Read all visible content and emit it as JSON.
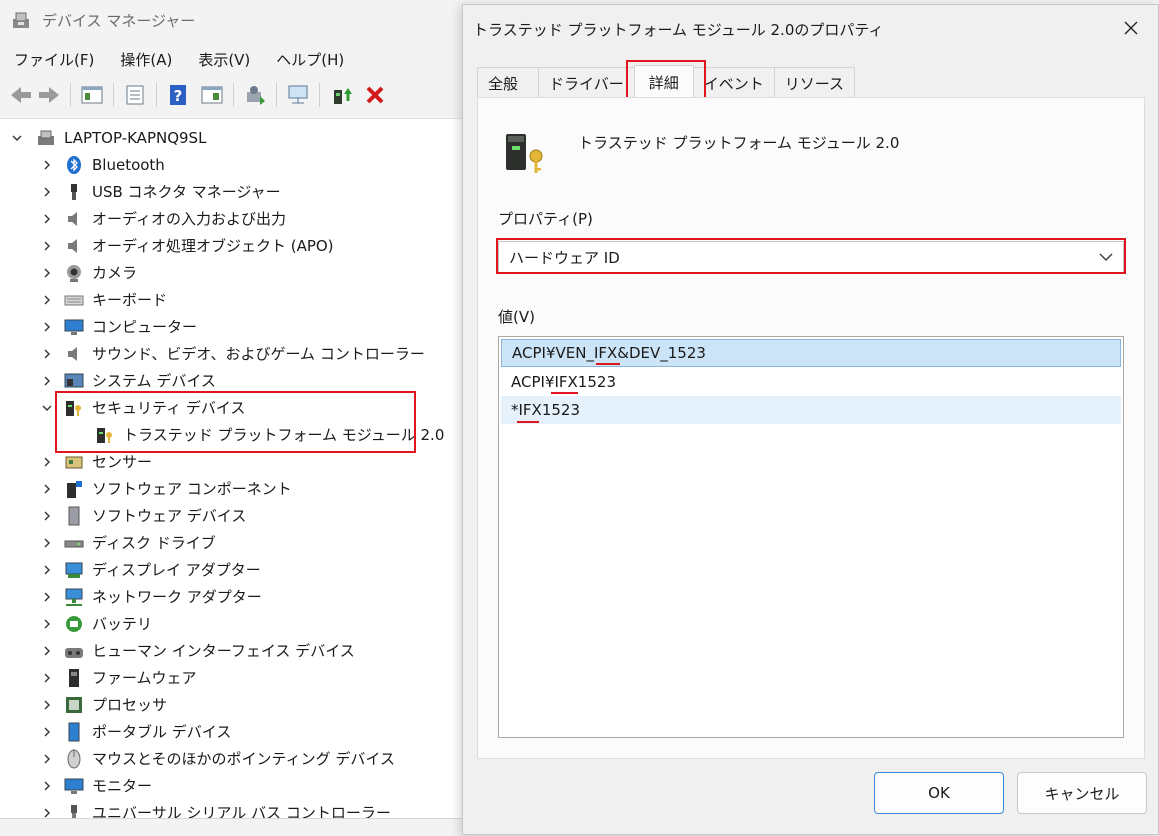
{
  "main": {
    "title": "デバイス マネージャー",
    "menu": [
      "ファイル(F)",
      "操作(A)",
      "表示(V)",
      "ヘルプ(H)"
    ],
    "root": "LAPTOP-KAPNQ9SL",
    "categories": [
      {
        "label": "Bluetooth",
        "icon": "bluetooth-icon"
      },
      {
        "label": "USB コネクタ マネージャー",
        "icon": "usb-connector-icon"
      },
      {
        "label": "オーディオの入力および出力",
        "icon": "speaker-icon"
      },
      {
        "label": "オーディオ処理オブジェクト (APO)",
        "icon": "speaker-icon"
      },
      {
        "label": "カメラ",
        "icon": "camera-icon"
      },
      {
        "label": "キーボード",
        "icon": "keyboard-icon"
      },
      {
        "label": "コンピューター",
        "icon": "monitor-icon"
      },
      {
        "label": "サウンド、ビデオ、およびゲーム コントローラー",
        "icon": "speaker-icon"
      },
      {
        "label": "システム デバイス",
        "icon": "system-device-icon"
      },
      {
        "label": "セキュリティ デバイス",
        "icon": "security-device-icon",
        "expanded": true
      },
      {
        "label": "トラステッド プラットフォーム モジュール 2.0",
        "icon": "security-device-icon",
        "child": true
      },
      {
        "label": "センサー",
        "icon": "sensor-icon"
      },
      {
        "label": "ソフトウェア コンポーネント",
        "icon": "software-component-icon"
      },
      {
        "label": "ソフトウェア デバイス",
        "icon": "software-device-icon"
      },
      {
        "label": "ディスク ドライブ",
        "icon": "disk-drive-icon"
      },
      {
        "label": "ディスプレイ アダプター",
        "icon": "display-adapter-icon"
      },
      {
        "label": "ネットワーク アダプター",
        "icon": "network-adapter-icon"
      },
      {
        "label": "バッテリ",
        "icon": "battery-icon"
      },
      {
        "label": "ヒューマン インターフェイス デバイス",
        "icon": "hid-icon"
      },
      {
        "label": "ファームウェア",
        "icon": "firmware-icon"
      },
      {
        "label": "プロセッサ",
        "icon": "processor-icon"
      },
      {
        "label": "ポータブル デバイス",
        "icon": "portable-device-icon"
      },
      {
        "label": "マウスとそのほかのポインティング デバイス",
        "icon": "mouse-icon"
      },
      {
        "label": "モニター",
        "icon": "monitor-icon"
      },
      {
        "label": "ユニバーサル シリアル バス コントローラー",
        "icon": "usb-icon"
      }
    ]
  },
  "dialog": {
    "title": "トラステッド プラットフォーム モジュール 2.0のプロパティ",
    "tabs": [
      "全般",
      "ドライバー",
      "詳細",
      "イベント",
      "リソース"
    ],
    "active_tab": "詳細",
    "device_name": "トラステッド プラットフォーム モジュール 2.0",
    "property_label": "プロパティ(P)",
    "property_value": "ハードウェア ID",
    "value_label": "値(V)",
    "values": [
      "ACPI¥VEN_IFX&DEV_1523",
      "ACPI¥IFX1523",
      "*IFX1523"
    ],
    "ok": "OK",
    "cancel": "キャンセル"
  },
  "colors": {
    "annotation": "#e0161f",
    "selection": "#cce4f7",
    "accent": "#3c88d6"
  }
}
